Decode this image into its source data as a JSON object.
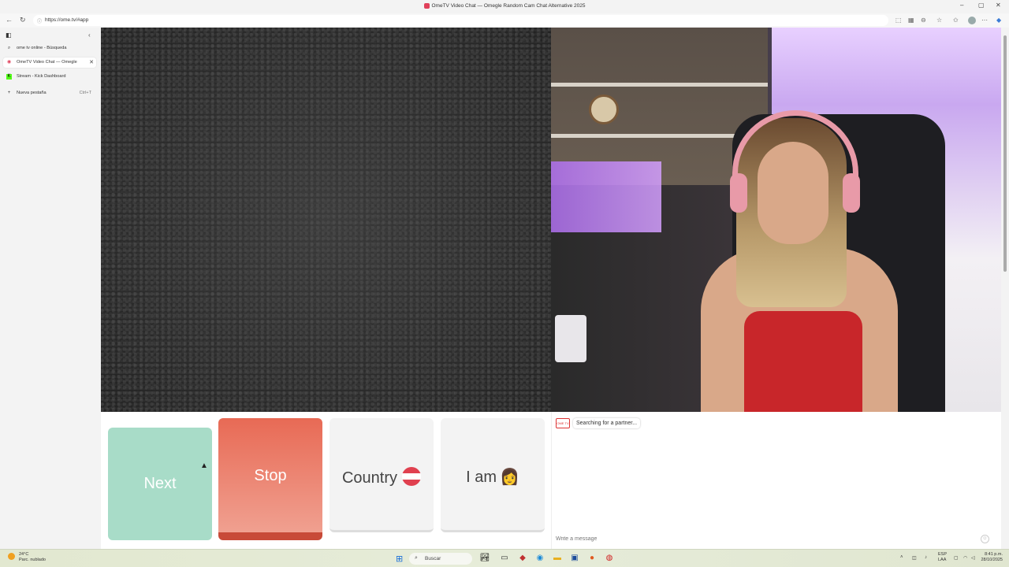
{
  "window": {
    "title": "OmeTV Video Chat — Omegle Random Cam Chat Alternative 2025",
    "controls": [
      "–",
      "▢",
      "✕"
    ]
  },
  "browser": {
    "url": "https://ome.tv/#app"
  },
  "sidebar": {
    "tabs": [
      {
        "label": "ome tv online - Búsqueda",
        "icon": "search-icon"
      },
      {
        "label": "OmeTV Video Chat — Omegle Random Cam Chat Alternative 2025",
        "icon": "ometv-favicon",
        "active": true
      },
      {
        "label": "Stream - Kick Dashboard",
        "icon": "kick-favicon"
      }
    ],
    "new_tab": {
      "label": "Nueva pestaña",
      "shortcut": "Ctrl+T"
    }
  },
  "controls": {
    "next_label": "Next",
    "stop_label": "Stop",
    "country_label": "Country",
    "iam_label": "I am",
    "iam_emoji": "👩"
  },
  "chat": {
    "status": "Searching for a partner...",
    "tv_icon_text": "OME TV",
    "input_placeholder": "Write a message"
  },
  "taskbar": {
    "weather_temp": "24°C",
    "weather_desc": "Parc. nublado",
    "search_label": "Buscar",
    "lang_top": "ESP",
    "lang_bottom": "LAA",
    "time": "8:41 p.m.",
    "date": "28/10/2025"
  },
  "colors": {
    "next": "#a8dcc8",
    "stop": "#e86a55",
    "panel": "#f3f3f3"
  }
}
